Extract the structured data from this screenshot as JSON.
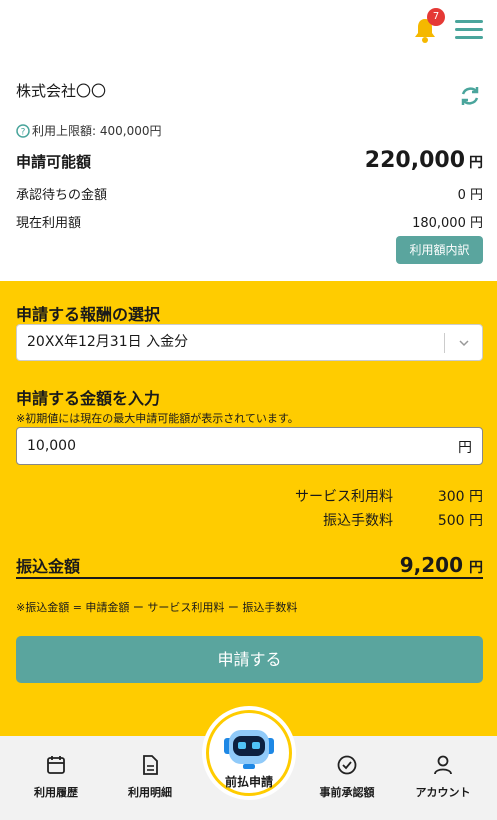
{
  "header": {
    "notification_count": "7"
  },
  "account": {
    "company": "株式会社〇〇",
    "limit_label": "利用上限額: 400,000円",
    "available_label": "申請可能額",
    "available_amount": "220,000",
    "yen": "円",
    "pending_label": "承認待ちの金額",
    "pending_amount": "0 円",
    "current_label": "現在利用額",
    "current_amount": "180,000 円",
    "detail_button": "利用額内訳"
  },
  "form": {
    "reward_heading": "申請する報酬の選択",
    "reward_selected": "20XX年12月31日 入金分",
    "amount_heading": "申請する金額を入力",
    "amount_note": "※初期値には現在の最大申請可能額が表示されています。",
    "amount_value": "10,000",
    "amount_unit": "円",
    "service_fee_label": "サービス利用料",
    "service_fee_value": "300 円",
    "transfer_fee_label": "振込手数料",
    "transfer_fee_value": "500 円",
    "transfer_label": "振込金額",
    "transfer_amount": "9,200",
    "transfer_yen": "円",
    "formula": "※振込金額 = 申請金額 ー サービス利用料 ー 振込手数料",
    "submit_button": "申請する"
  },
  "nav": {
    "history": "利用履歴",
    "statement": "利用明細",
    "prepay": "前払申請",
    "preapproved": "事前承認額",
    "account": "アカウント"
  },
  "colors": {
    "accent": "#5aa59e",
    "yellow": "#ffcc00",
    "badge": "#e53935"
  }
}
